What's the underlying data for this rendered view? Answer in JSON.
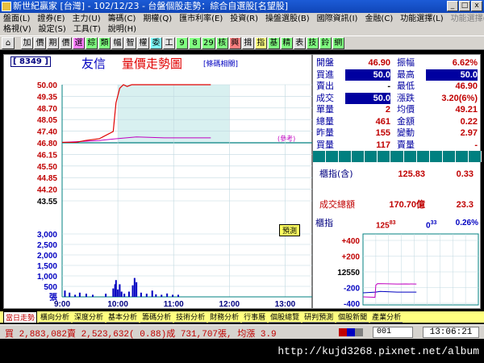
{
  "window": {
    "title": "新世紀贏家 [台灣] - 102/12/23 - 台盤個股走勢：綜合自選股[名望股]",
    "btn_min": "_",
    "btn_max": "□",
    "btn_close": "x"
  },
  "menu": {
    "row1": [
      "盤面(L)",
      "證券(E)",
      "主力(U)",
      "籌碼(C)",
      "期權(Q)",
      "匯市利率(E)",
      "投資(R)",
      "操盤選股(B)",
      "國際資訊(I)",
      "金融(C)",
      "功能選擇(L)",
      "功能選擇(Z)"
    ],
    "row2": [
      "格視(V)",
      "設定(S)",
      "工具(T)",
      "說明(H)"
    ]
  },
  "toolbar": {
    "buttons": [
      "加",
      "價",
      "期",
      "價",
      "選",
      "綜",
      "類",
      "幅",
      "智",
      "權",
      "委",
      "工",
      "9",
      "8",
      "29",
      "核",
      "興",
      "揖",
      "指",
      "基",
      "精",
      "表",
      "技",
      "鈴",
      "網"
    ]
  },
  "chart": {
    "code": "[ 8349 ]",
    "name": "友信",
    "title": "量價走勢圖",
    "link": "[條碼相關]",
    "predict": "預測",
    "ref_tag": "(參考)",
    "price_labels": [
      "50.00",
      "49.35",
      "48.70",
      "48.05",
      "47.40",
      "46.80",
      "46.15",
      "45.50",
      "44.85",
      "44.20",
      "43.55"
    ],
    "vol_labels": [
      "3,000",
      "2,500",
      "2,000",
      "1,500",
      "1,000",
      "500",
      "張"
    ],
    "time_labels": [
      "9:00",
      "10:00",
      "11:00",
      "12:00",
      "13:00"
    ]
  },
  "chart_data": {
    "type": "line",
    "title": "量價走勢圖",
    "x_axis": [
      "9:00",
      "10:00",
      "11:00",
      "12:00",
      "13:00"
    ],
    "ylim": [
      43.55,
      50.0
    ],
    "reference_price": 46.8,
    "series": [
      {
        "name": "price",
        "points": [
          [
            0,
            46.8
          ],
          [
            15,
            46.8
          ],
          [
            25,
            46.9
          ],
          [
            40,
            47.0
          ],
          [
            55,
            47.4
          ],
          [
            58,
            49.0
          ],
          [
            62,
            49.8
          ],
          [
            66,
            50.0
          ],
          [
            70,
            49.9
          ],
          [
            75,
            50.0
          ],
          [
            80,
            50.0
          ],
          [
            100,
            50.0
          ],
          [
            125,
            50.0
          ],
          [
            160,
            50.0
          ]
        ]
      },
      {
        "name": "avg",
        "points": [
          [
            0,
            46.8
          ],
          [
            40,
            46.9
          ],
          [
            58,
            47.0
          ],
          [
            80,
            47.1
          ],
          [
            110,
            47.05
          ],
          [
            160,
            47.05
          ]
        ]
      }
    ],
    "volume": [
      {
        "t": 3,
        "v": 300
      },
      {
        "t": 8,
        "v": 200
      },
      {
        "t": 14,
        "v": 100
      },
      {
        "t": 19,
        "v": 200
      },
      {
        "t": 26,
        "v": 150
      },
      {
        "t": 33,
        "v": 100
      },
      {
        "t": 47,
        "v": 150
      },
      {
        "t": 55,
        "v": 400
      },
      {
        "t": 57,
        "v": 600
      },
      {
        "t": 58,
        "v": 800
      },
      {
        "t": 60,
        "v": 350
      },
      {
        "t": 62,
        "v": 600
      },
      {
        "t": 64,
        "v": 250
      },
      {
        "t": 67,
        "v": 150
      },
      {
        "t": 72,
        "v": 250
      },
      {
        "t": 76,
        "v": 550
      },
      {
        "t": 78,
        "v": 900
      },
      {
        "t": 80,
        "v": 700
      },
      {
        "t": 85,
        "v": 200
      },
      {
        "t": 91,
        "v": 150
      },
      {
        "t": 97,
        "v": 300
      },
      {
        "t": 101,
        "v": 120
      },
      {
        "t": 107,
        "v": 100
      },
      {
        "t": 113,
        "v": 160
      },
      {
        "t": 119,
        "v": 100
      },
      {
        "t": 125,
        "v": 100
      }
    ],
    "vol_max": 3000
  },
  "quote": {
    "rows": [
      {
        "l1": "開盤",
        "v1": "46.90",
        "c1": "#c00000",
        "l2": "振幅",
        "v2": "6.62%",
        "c2": "#c00000"
      },
      {
        "l1": "買進",
        "v1": "50.0",
        "c1": "box",
        "l2": "最高",
        "v2": "50.0",
        "c2": "box"
      },
      {
        "l1": "賣出",
        "v1": "-",
        "c1": "#000",
        "l2": "最低",
        "v2": "46.90",
        "c2": "#c00000"
      },
      {
        "l1": "成交",
        "v1": "50.0",
        "c1": "box",
        "l2": "漲跌",
        "v2": "3.20(6%)",
        "c2": "#c00000"
      },
      {
        "l1": "單量",
        "v1": "2",
        "c1": "#c00000",
        "l2": "均價",
        "v2": "49.21",
        "c2": "#c00000"
      },
      {
        "l1": "總量",
        "v1": "461",
        "c1": "#c00000",
        "l2": "金額",
        "v2": "0.22",
        "c2": "#c00000"
      },
      {
        "l1": "昨量",
        "v1": "155",
        "c1": "#c00000",
        "l2": "變動",
        "v2": "2.97",
        "c2": "#c00000"
      },
      {
        "l1": "買量",
        "v1": "117",
        "c1": "#c00000",
        "l2": "賣量",
        "v2": "-",
        "c2": "#c00000"
      }
    ],
    "index_label": "櫃指(含)",
    "index_val": "125.83",
    "index_chg": "0.33",
    "turnover_label": "成交總額",
    "turnover_val": "170.70億",
    "turnover_chg": "23.3",
    "mini": {
      "label": "櫃指",
      "val": "125",
      "val_sup": "83",
      "chg": "0",
      "chg_sup": "33",
      "pct": "0.26%",
      "ylabels": [
        "+400",
        "+200",
        "12550",
        "-200",
        "-400"
      ],
      "index_line": [
        [
          0,
          0.15
        ],
        [
          25,
          0.13
        ],
        [
          28,
          0.12
        ],
        [
          30,
          0.9
        ],
        [
          34,
          1.0
        ],
        [
          50,
          0.99
        ],
        [
          80,
          0.97
        ],
        [
          100,
          0.98
        ],
        [
          125,
          0.97
        ]
      ],
      "flat_line": [
        [
          0,
          0.05
        ],
        [
          30,
          0.06
        ],
        [
          40,
          0.07
        ],
        [
          80,
          0.06
        ],
        [
          125,
          0.06
        ]
      ]
    }
  },
  "tabs": [
    "當日走勢",
    "橫向分析",
    "深度分析",
    "基本分析",
    "籌碼分析",
    "技術分析",
    "財務分析",
    "行事曆",
    "個股總覽",
    "研判預測",
    "個股新聞",
    "產業分析"
  ],
  "status": {
    "text": "買 2,883,082賣 2,523,632( 0.88)成 731,707張, 均漲 3.9",
    "count": "001",
    "time": "13:06:21"
  },
  "watermark": "http://kujd3268.pixnet.net/album"
}
